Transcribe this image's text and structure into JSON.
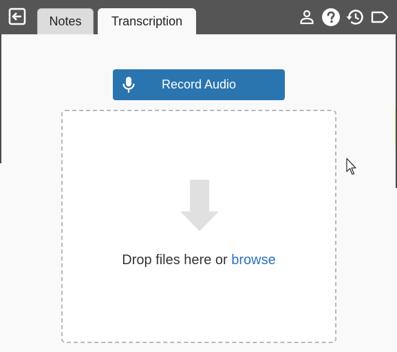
{
  "topbar": {
    "tabs": [
      {
        "label": "Notes",
        "active": false
      },
      {
        "label": "Transcription",
        "active": true
      }
    ],
    "icons": [
      "exit-icon",
      "user-icon",
      "help-icon",
      "history-icon",
      "tag-icon"
    ]
  },
  "main": {
    "record_button": {
      "label": "Record Audio",
      "icon": "microphone-icon"
    },
    "dropzone": {
      "text": "Drop files here or",
      "browse_label": "browse",
      "icon": "download-arrow-icon"
    }
  },
  "colors": {
    "topbar": "#555555",
    "accent": "#2a74b0",
    "link": "#2a74c0",
    "background": "#f9f9f9"
  }
}
